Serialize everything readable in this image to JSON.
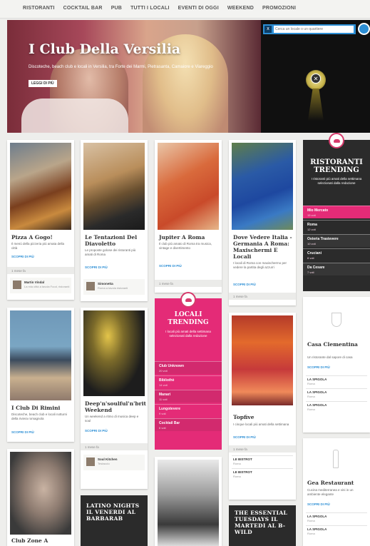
{
  "nav": {
    "items": [
      "RISTORANTI",
      "COCKTAIL BAR",
      "PUB",
      "TUTTI I LOCALI",
      "EVENTI DI OGGI",
      "WEEKEND",
      "PROMOZIONI"
    ]
  },
  "hero": {
    "title": "I Club Della Versilia",
    "subtitle": "Discoteche, beach club e locali in Versilia, tra Forte dei Marmi, Pietrasanta, Camaiore e Viareggio",
    "button": "LEGGI DI PIÙ"
  },
  "video": {
    "search_placeholder": "Cerca un locale o un quartiere",
    "search_close": "x"
  },
  "cards": {
    "pizza": {
      "title": "Pizza A Gogo!",
      "desc": "Il menù della pizzeria più amata della città",
      "link": "SCOPRI DI PIÙ",
      "meta": "1 mese fa",
      "author": "Martin Vindal",
      "author_sub": "La mia città a tavola\nFood, ristoranti"
    },
    "tentazioni": {
      "title": "Le Tentazioni Del Diavoletto",
      "desc": "Le proposte golose dei ristoranti più amati di Roma",
      "link": "SCOPRI DI PIÙ",
      "author": "Simonetta",
      "author_sub": "Roma a tavola\nristoranti"
    },
    "jupiter": {
      "title": "Jupiter A Roma",
      "desc": "Il club più amato di Roma tra musica, vintage e divertimento",
      "link": "SCOPRI DI PIÙ",
      "meta": "1 mese fa"
    },
    "vedere": {
      "title": "Dove Vedere Italia - Germania A Roma: Maxischermi E Locali",
      "desc": "I locali di Roma con maxischermo per vedere la partita degli azzurri",
      "link": "SCOPRI DI PIÙ",
      "meta": "1 mese fa"
    },
    "rimini": {
      "title": "I Club Di Rimini",
      "desc": "Discoteche, beach club e locali notturni della riviera romagnola",
      "link": "SCOPRI DI PIÙ"
    },
    "deep": {
      "title": "Deep'n'soulful'n'brit Weekend",
      "desc": "Un weekend a ritmo di musica deep e soul",
      "link": "SCOPRI DI PIÙ",
      "meta": "1 mese fa",
      "author": "Soul Kitchen",
      "author_sub": "Testaccio"
    },
    "topfive": {
      "title": "Topfive",
      "desc": "I cinque locali più amati della settimana",
      "link": "SCOPRI DI PIÙ",
      "meta": "1 mese fa"
    },
    "casa": {
      "title": "Casa Clementina",
      "desc": "Un ristorante dal sapore di casa",
      "link": "SCOPRI DI PIÙ"
    },
    "gea": {
      "title": "Gea Restaurant",
      "desc": "Cucina mediterranea e vini in un ambiente elegante",
      "link": "SCOPRI DI PIÙ"
    },
    "club": {
      "title": "Club Zone A"
    }
  },
  "trending_ristoranti": {
    "title": "RISTORANTI TRENDING",
    "subtitle": "I ristoranti più amati della settimana selezionati dalla redazione",
    "rows": [
      {
        "name": "Mio Mercato",
        "count": "15 voti"
      },
      {
        "name": "Roma",
        "count": "12 voti"
      },
      {
        "name": "Osteria Trastevere",
        "count": "10 voti"
      },
      {
        "name": "Cruciani",
        "count": "8 voti"
      },
      {
        "name": "Da Cesare",
        "count": "7 voti"
      }
    ]
  },
  "trending_locali": {
    "title": "LOCALI TRENDING",
    "subtitle": "I locali più amati della settimana selezionati dalla redazione",
    "rows": [
      {
        "name": "Club Unknown",
        "count": "20 voti"
      },
      {
        "name": "Bibliothè",
        "count": "14 voti"
      },
      {
        "name": "Manari",
        "count": "11 voti"
      },
      {
        "name": "Lungotevere",
        "count": "9 voti"
      },
      {
        "name": "Cocktail Bar",
        "count": "6 voti"
      }
    ]
  },
  "promos": {
    "latino": "LATINO NIGHTS IL VENERDI AL BARBARAB",
    "essential": "THE ESSENTIAL TUESDAYS IL MARTEDI AL B-WILD"
  },
  "topfive_list": [
    {
      "name": "LE BISTROT",
      "count": "Roma"
    },
    {
      "name": "LE BISTROT",
      "count": "Roma"
    }
  ],
  "casa_list": [
    {
      "name": "LA SPIGOLA",
      "count": "Roma"
    },
    {
      "name": "LA SPIGOLA",
      "count": "Roma"
    },
    {
      "name": "LA SPIGOLA",
      "count": "Roma"
    }
  ],
  "gea_list": [
    {
      "name": "LA SPIGOLA",
      "count": "Roma"
    },
    {
      "name": "LA SPIGOLA",
      "count": "Roma"
    }
  ],
  "colors": {
    "accent": "#d63b6c",
    "blue": "#2d8fd5",
    "dark": "#2b2b2b"
  }
}
